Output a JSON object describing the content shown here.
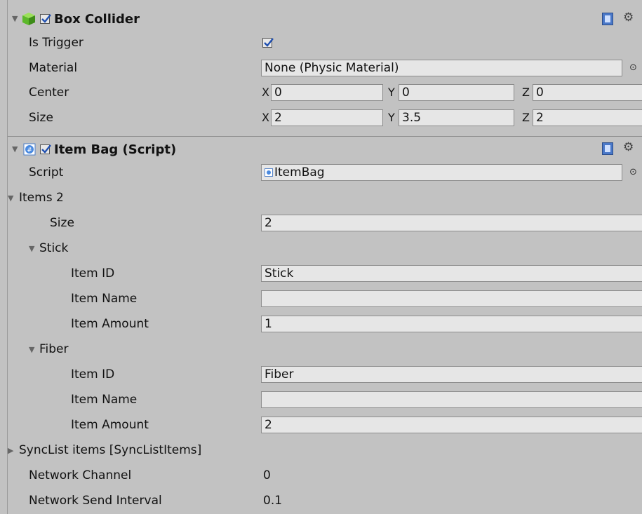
{
  "box_collider": {
    "title": "Box Collider",
    "is_trigger_label": "Is Trigger",
    "is_trigger_checked": true,
    "material_label": "Material",
    "material_value": "None (Physic Material)",
    "center_label": "Center",
    "center": {
      "x_label": "X",
      "x": "0",
      "y_label": "Y",
      "y": "0",
      "z_label": "Z",
      "z": "0"
    },
    "size_label": "Size",
    "size": {
      "x_label": "X",
      "x": "2",
      "y_label": "Y",
      "y": "3.5",
      "z_label": "Z",
      "z": "2"
    }
  },
  "item_bag": {
    "title": "Item Bag (Script)",
    "script_label": "Script",
    "script_value": "ItemBag",
    "items_label": "Items 2",
    "size_label": "Size",
    "size_value": "2",
    "items": [
      {
        "header": "Stick",
        "id_label": "Item ID",
        "id_value": "Stick",
        "name_label": "Item Name",
        "name_value": "",
        "amount_label": "Item Amount",
        "amount_value": "1"
      },
      {
        "header": "Fiber",
        "id_label": "Item ID",
        "id_value": "Fiber",
        "name_label": "Item Name",
        "name_value": "",
        "amount_label": "Item Amount",
        "amount_value": "2"
      }
    ],
    "synclist_label": "SyncList items  [SyncListItems]",
    "network_channel_label": "Network Channel",
    "network_channel_value": "0",
    "network_send_interval_label": "Network Send Interval",
    "network_send_interval_value": "0.1"
  },
  "icons": {
    "fold_open": "▼",
    "fold_closed": "▶",
    "picker": "⊙",
    "gear": "⚙"
  },
  "colors": {
    "panel_bg": "#c2c2c2",
    "field_bg": "#e6e6e6",
    "field_border": "#8c8c8c"
  }
}
